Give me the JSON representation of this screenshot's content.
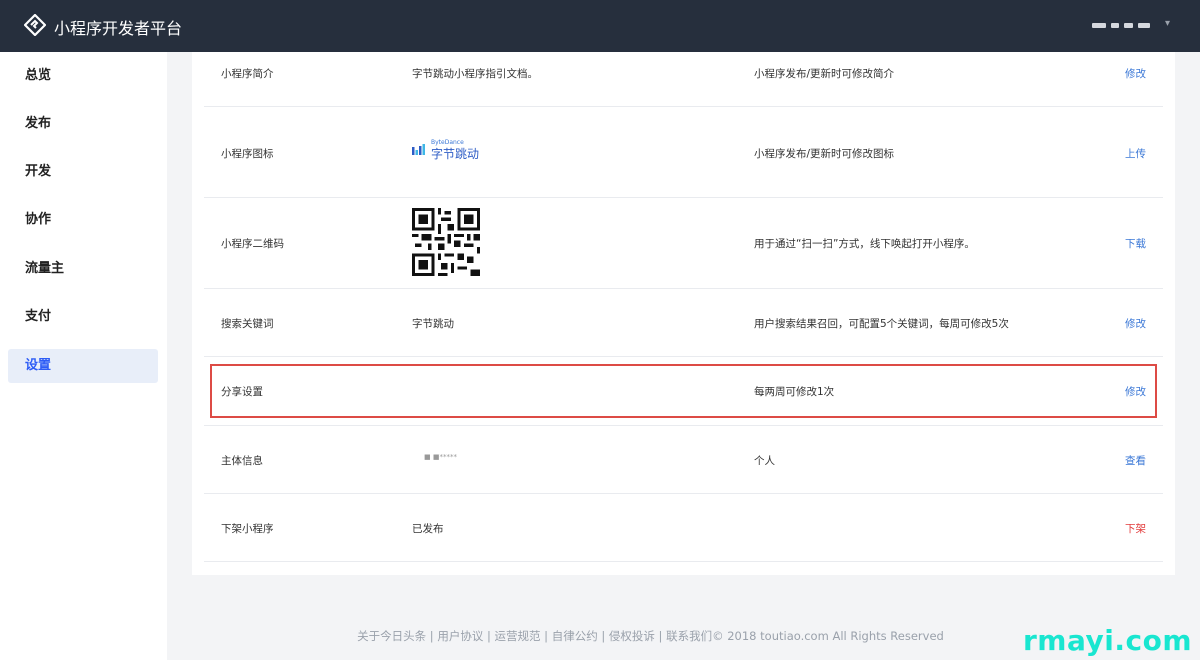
{
  "header": {
    "brand": "小程序开发者平台",
    "logo_icon": "bytedance-miniapp-logo-icon",
    "user_menu_caret": "▾"
  },
  "sidebar": {
    "items": [
      {
        "label": "总览",
        "active": false
      },
      {
        "label": "发布",
        "active": false
      },
      {
        "label": "开发",
        "active": false
      },
      {
        "label": "协作",
        "active": false
      },
      {
        "label": "流量主",
        "active": false
      },
      {
        "label": "支付",
        "active": false
      },
      {
        "label": "设置",
        "active": true
      }
    ]
  },
  "settings": {
    "rows": [
      {
        "label": "小程序简介",
        "value": "字节跳动小程序指引文档。",
        "desc": "小程序发布/更新时可修改简介",
        "action": "修改"
      },
      {
        "label": "小程序图标",
        "value_logo_small": "ByteDance",
        "value_logo_main": "字节跳动",
        "desc": "小程序发布/更新时可修改图标",
        "action": "上传"
      },
      {
        "label": "小程序二维码",
        "value_icon": "qr-code-icon",
        "desc": "用于通过“扫一扫”方式，线下唤起打开小程序。",
        "action": "下载"
      },
      {
        "label": "搜索关键词",
        "value": "字节跳动",
        "desc": "用户搜索结果召回，可配置5个关键词，每周可修改5次",
        "action": "修改"
      },
      {
        "label": "分享设置",
        "value": "",
        "desc": "每两周可修改1次",
        "action": "修改"
      },
      {
        "label": "主体信息",
        "value": "■ ■*****",
        "desc": "个人",
        "action": "查看"
      },
      {
        "label": "下架小程序",
        "value": "已发布",
        "desc": "",
        "action": "下架"
      }
    ]
  },
  "footer": {
    "text": "关于今日头条 | 用户协议 | 运营规范 | 自律公约 | 侵权投诉 | 联系我们© 2018 toutiao.com All Rights Reserved"
  },
  "watermark": "rmayi.com",
  "colors": {
    "topbar": "#262f3d",
    "link": "#3a77d6",
    "danger": "#e23b3b",
    "highlight_border": "#dd4b45",
    "active_nav_bg": "#e8eef9",
    "watermark": "#19e6d0"
  }
}
